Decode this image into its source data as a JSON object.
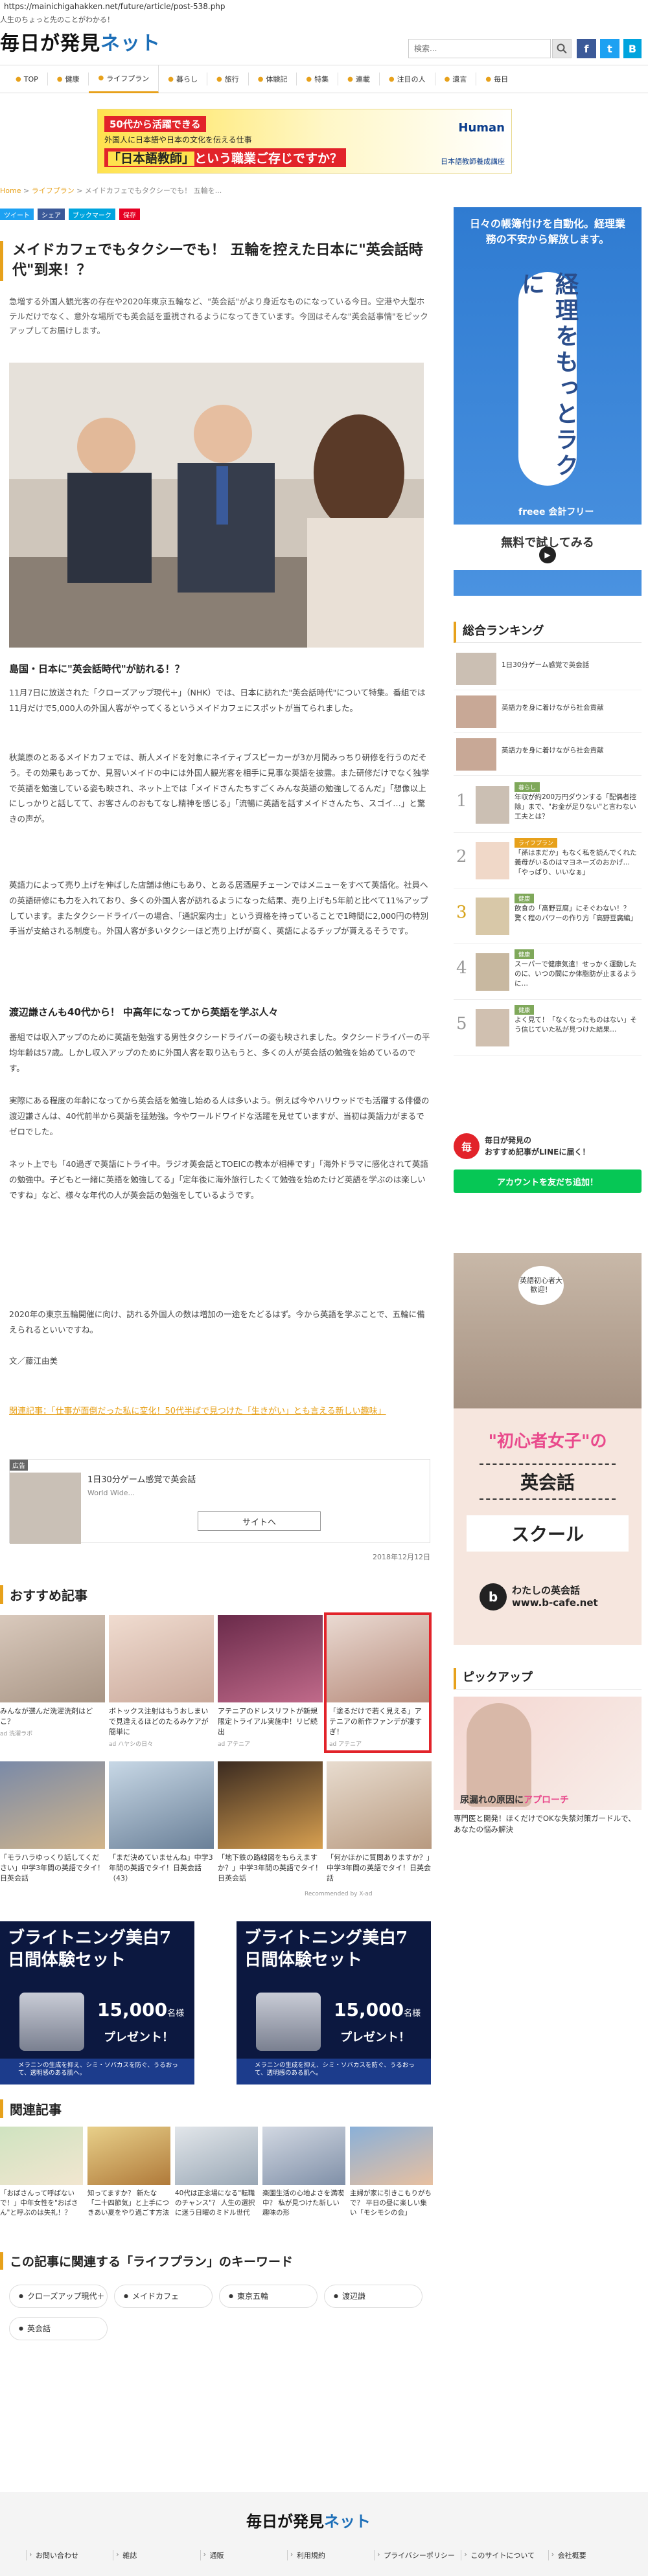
{
  "url": "https://mainichigahakken.net/future/article/post-538.php",
  "site": {
    "tagline": "人生のちょっと先のことがわかる！",
    "logo_main": "毎日が発見",
    "logo_accent": "ネット",
    "search_placeholder": "検索..."
  },
  "nav": [
    {
      "label": "TOP"
    },
    {
      "label": "健康"
    },
    {
      "label": "ライフプラン"
    },
    {
      "label": "暮らし"
    },
    {
      "label": "旅行"
    },
    {
      "label": "体験記"
    },
    {
      "label": "特集"
    },
    {
      "label": "連載"
    },
    {
      "label": "注目の人"
    },
    {
      "label": "遺言"
    },
    {
      "label": "毎日"
    }
  ],
  "banner": {
    "badge": "50代から活躍できる",
    "line2": "外国人に日本語や日本の文化を伝える仕事",
    "line3a": "「日本語教師」",
    "line3b": "という職業ご存じですか？",
    "brand": "Human",
    "brand2": "日本語教師養成講座"
  },
  "breadcrumb": {
    "home": "Home",
    "sep": " > ",
    "cat": "ライフプラン",
    "current": "メイドカフェでもタクシーでも！ 五輪を..."
  },
  "share": [
    {
      "label": "ツイート",
      "color": "#1da1f2"
    },
    {
      "label": "シェア",
      "color": "#3b5998"
    },
    {
      "label": "ブックマーク",
      "color": "#00a4de"
    },
    {
      "label": "保存",
      "color": "#e60023"
    }
  ],
  "article": {
    "title": "メイドカフェでもタクシーでも！ 五輪を控えた日本に\"英会話時代\"到来！？",
    "lead": "急増する外国人観光客の存在や2020年東京五輪など、\"英会話\"がより身近なものになっている今日。空港や大型ホテルだけでなく、意外な場所でも英会話を重視されるようになってきています。今回はそんな\"英会話事情\"をピックアップしてお届けします。",
    "h1": "島国・日本に\"英会話時代\"が訪れる！？",
    "p1": "11月7日に放送された「クローズアップ現代＋」（NHK）では、日本に訪れた\"英会話時代\"について特集。番組では11月だけで5,000人の外国人客がやってくるというメイドカフェにスポットが当てられました。",
    "p2": "秋葉原のとあるメイドカフェでは、新人メイドを対象にネイティブスピーカーが3か月間みっちり研修を行うのだそう。その効果もあってか、見習いメイドの中には外国人観光客を相手に見事な英語を披露。また研修だけでなく独学で英語を勉強している姿も映され、ネット上では「メイドさんたちすごくみんな英語の勉強してるんだ」「想像以上にしっかりと話してて、お客さんのおもてなし精神を感じる」「流暢に英語を話すメイドさんたち、スゴイ…」と驚きの声が。",
    "p3": "英語力によって売り上げを伸ばした店舗は他にもあり、とある居酒屋チェーンではメニューをすべて英語化。社員への英語研修にも力を入れており、多くの外国人客が訪れるようになった結果、売り上げも5年前と比べて11%アップしています。またタクシードライバーの場合、「通訳案内士」という資格を持っていることで1時間に2,000円の特別手当が支給される制度も。外国人客が多いタクシーほど売り上げが高く、英語によるチップが貰えるそうです。",
    "h2": "渡辺謙さんも40代から！ 中高年になってから英語を学ぶ人々",
    "p4": "番組では収入アップのために英語を勉強する男性タクシードライバーの姿も映されました。タクシードライバーの平均年齢は57歳。しかし収入アップのために外国人客を取り込もうと、多くの人が英会話の勉強を始めているのです。",
    "p5": "実際にある程度の年齢になってから英会話を勉強し始める人は多いよう。例えば今やハリウッドでも活躍する俳優の渡辺謙さんは、40代前半から英語を猛勉強。今やワールドワイドな活躍を見せていますが、当初は英語力がまるでゼロでした。",
    "p6": "ネット上でも「40過ぎで英語にトライ中。ラジオ英会話とTOEICの教本が相棒です」「海外ドラマに感化されて英語の勉強中。子どもと一緒に英語を勉強してる」「定年後に海外旅行したくて勉強を始めたけど英語を学ぶのは楽しいですね」など、様々な年代の人が英会話の勉強をしているようです。",
    "p7": "2020年の東京五輪開催に向け、訪れる外国人の数は増加の一途をたどるはず。今から英語を学ぶことで、五輪に備えられるといいですね。",
    "author": "文／藤江由美",
    "related_link": "関連記事：「仕事が面倒だった私に変化！50代半ばで見つけた「生きがい」とも言える新しい趣味」",
    "date": "2018年12月12日"
  },
  "inline_ad": {
    "tag": "広告",
    "title": "1日30分ゲーム感覚で英会話",
    "sub": "World Wide...",
    "button": "サイトへ"
  },
  "recommend": {
    "title": "おすすめ記事",
    "items": [
      {
        "caption": "みんなが選んだ洗濯洗剤はどこ？",
        "src": "ad 洗濯ラボ"
      },
      {
        "caption": "ボトックス注射はもうおしまいで見違えるほどのたるみケアが簡単に",
        "src": "ad ハヤシの日々"
      },
      {
        "caption": "アテニアのドレスリフトが新規限定トライアル実施中！リピ続出",
        "src": "ad アテニア"
      },
      {
        "caption": "「塗るだけで若く見える」アテニアの新作ファンデが凄すぎ！",
        "src": "ad アテニア"
      },
      {
        "caption": "「モラハラゆっくり話してください」中学3年間の英語でタイ！日英会話",
        "src": ""
      },
      {
        "caption": "「まだ決めていませんね」中学3年間の英語でタイ！日英会話（43）",
        "src": ""
      },
      {
        "caption": "「地下鉄の路線図をもらえますか？」中学3年間の英語でタイ！日英会話",
        "src": ""
      },
      {
        "caption": "「何かほかに質問ありますか？」中学3年間の英語でタイ！日英会話",
        "src": ""
      }
    ],
    "by": "Recommended by X-ad"
  },
  "big_ads": [
    {
      "headline": "ブライトニング美白7日間体験セット",
      "amount": "15,000",
      "unit": "名様",
      "sub": "プレゼント！",
      "foot": "メラニンの生成を抑え、シミ・ソバカスを防ぐ、うるおって、透明感のある肌へ。"
    },
    {
      "headline": "ブライトニング美白7日間体験セット",
      "amount": "15,000",
      "unit": "名様",
      "sub": "プレゼント！",
      "foot": "メラニンの生成を抑え、シミ・ソバカスを防ぐ、うるおって、透明感のある肌へ。"
    }
  ],
  "related": {
    "title": "関連記事",
    "items": [
      {
        "caption": "「おばさんって呼ばないで！」中年女性を\"おばさん\"と呼ぶのは失礼！？"
      },
      {
        "caption": "知ってますか？ 新たな「二十四節気」と上手につきあい夏をやり過ごす方法"
      },
      {
        "caption": "40代は正念場になる\"転職のチャンス\"？ 人生の選択に迷う日曜のミドル世代"
      },
      {
        "caption": "楽園生活の心地よさを満喫中？ 私が見つけた新しい趣味の形"
      },
      {
        "caption": "主婦が家に引きこもりがちで？ 平日の昼に楽しい集い「モシモシの会」"
      }
    ]
  },
  "keywords": {
    "title": "この記事に関連する「ライフプラン」のキーワード",
    "items": [
      "クローズアップ現代＋",
      "メイドカフェ",
      "東京五輪",
      "渡辺謙",
      "英会話"
    ]
  },
  "footer": {
    "logo_main": "毎日が発見",
    "logo_accent": "ネット",
    "links": [
      "お問い合わせ",
      "雑誌",
      "通販",
      "利用規約",
      "プライバシーポリシー",
      "このサイトについて",
      "会社概要"
    ]
  },
  "side_ad1": {
    "top": "日々の帳簿付けを自動化。経理業務の不安から解放します。",
    "vertical": "経理をもっとラクに",
    "brand": "freee 会計フリー",
    "cta": "無料で試してみる"
  },
  "ranking": {
    "title": "総合ランキング",
    "items": [
      {
        "caption": "1日30分ゲーム感覚で英会話",
        "cat": ""
      },
      {
        "caption": "英語力を身に着けながら社会貢献",
        "cat": ""
      },
      {
        "caption": "英語力を身に着けながら社会貢献",
        "cat": ""
      },
      {
        "num": "1",
        "cat": "暮らし",
        "caption": "年収が約200万円ダウンする「配偶者控除」まで、\"お金が足りない\"と言わない工夫とは？"
      },
      {
        "num": "2",
        "cat": "ライフプラン",
        "caption": "「孫はまだか」もなく私を読んでくれた義母がいるのはマヨネーズのおかげ…「やっぱり、いいなぁ」"
      },
      {
        "num": "3",
        "cat": "健康",
        "caption": "飲食の「高野豆腐」にそぐわない！？ 驚く程のパワーの作り方「高野豆腐編」"
      },
      {
        "num": "4",
        "cat": "健康",
        "caption": "スーパーで健康気遣！せっかく運動したのに、いつの間にか体脂肪が止まるように…"
      },
      {
        "num": "5",
        "cat": "健康",
        "caption": "よく見て！「なくなったものはない」そう信じていた私が見つけた結果…"
      }
    ]
  },
  "line_box": {
    "icon": "毎",
    "text": "毎日が発見の\nおすすめ記事がLINEに届く！",
    "button": "アカウントを友だち追加！"
  },
  "side_ad2": {
    "bubble": "英語初心者大歓迎！",
    "h1": "\"初心者女子\"の",
    "h2": "英会話",
    "h3": "スクール",
    "brand_icon": "b",
    "brand": "わたしの英会話\nwww.b-cafe.net"
  },
  "pickup": {
    "title": "ピックアップ",
    "overlay_a": "尿漏れの原因に",
    "overlay_b": "アプローチ",
    "caption": "専門医と開発！ほくだけでOKな失禁対策ガードルで、あなたの悩み解決"
  },
  "colors": {
    "accent": "#e7a11b",
    "brand_blue": "#1d6fb8",
    "twitter": "#1da1f2",
    "facebook": "#3b5998",
    "line_green": "#06c755"
  }
}
